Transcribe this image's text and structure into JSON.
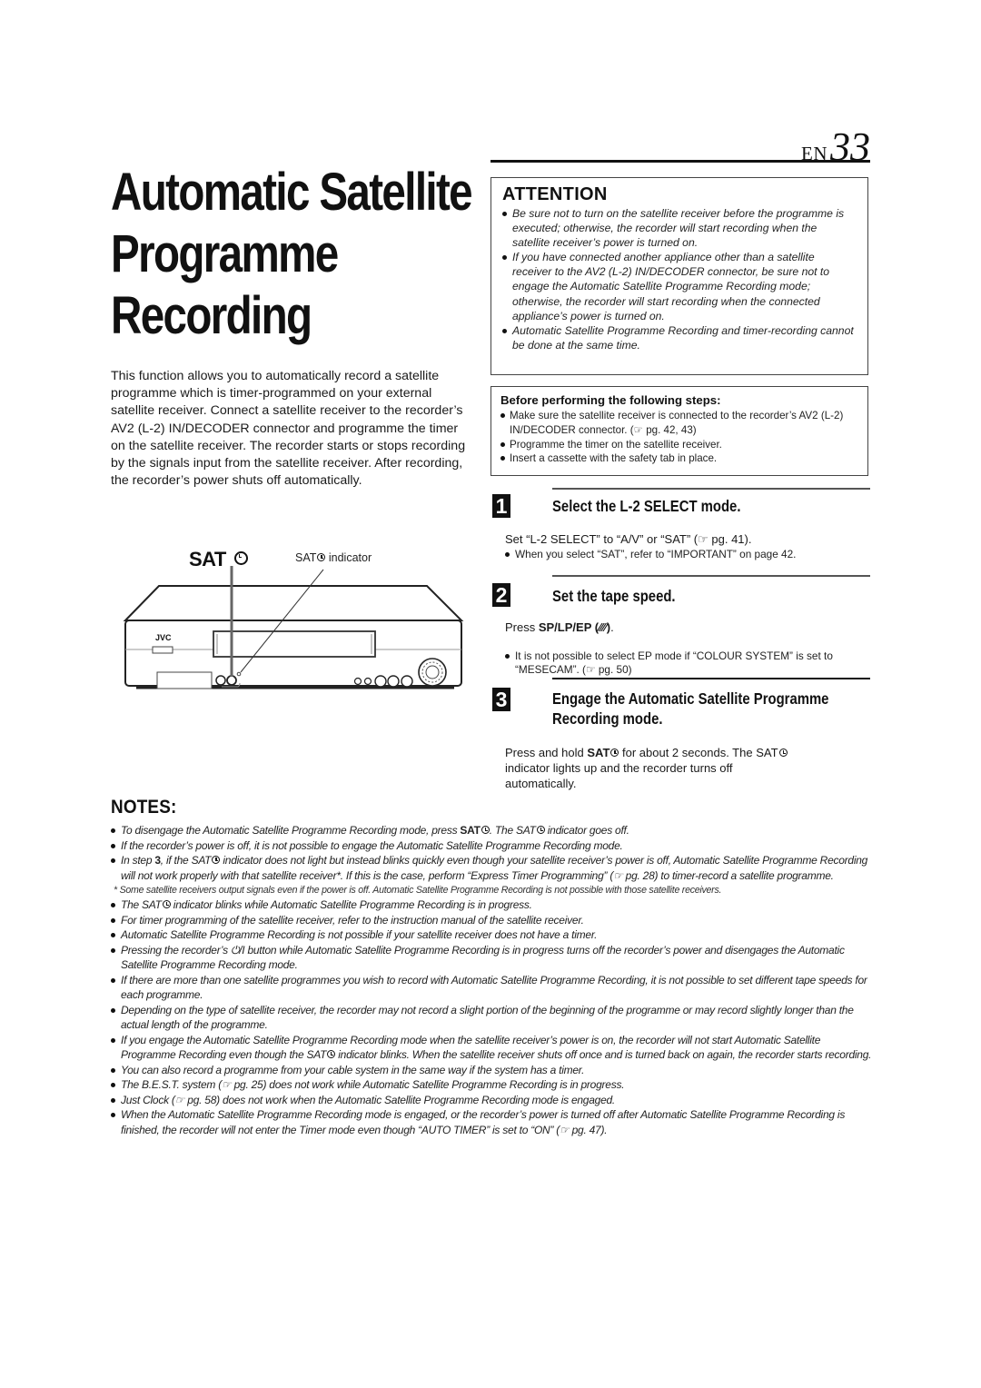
{
  "header": {
    "lang": "EN",
    "page_number": "33"
  },
  "title": {
    "line1": "Automatic Satellite",
    "line2": "Programme",
    "line3": "Recording"
  },
  "intro": "This function allows you to automatically record a satellite programme which is timer-programmed on your external satellite receiver. Connect a satellite receiver to the recorder’s AV2 (L-2) IN/DECODER connector and programme the timer on the satellite receiver. The recorder starts or stops recording by the signals input from the satellite receiver. After recording, the recorder’s power shuts off automatically.",
  "diagram": {
    "button_label": "SAT",
    "indicator_label": "SAT",
    "indicator_suffix": " indicator",
    "brand": "JVC"
  },
  "attention": {
    "heading": "ATTENTION",
    "items": [
      "Be sure not to turn on the satellite receiver before the programme is executed; otherwise, the recorder will start recording when the satellite receiver’s power is turned on.",
      "If you have connected another appliance other than a satellite receiver to the AV2 (L-2) IN/DECODER connector, be sure not to engage the Automatic Satellite Programme Recording mode; otherwise, the recorder will start recording when the connected appliance’s power is turned on.",
      "Automatic Satellite Programme Recording and timer-recording cannot be done at the same time."
    ]
  },
  "before": {
    "heading": "Before performing the following steps:",
    "items": [
      "Make sure the satellite receiver is connected to the recorder’s AV2 (L-2) IN/DECODER connector. (☞ pg. 42, 43)",
      "Programme the timer on the satellite receiver.",
      "Insert a cassette with the safety tab in place."
    ]
  },
  "steps": [
    {
      "number": "1",
      "title": "Select the L-2 SELECT mode.",
      "body": "Set  “L-2 SELECT” to “A/V” or “SAT” (☞ pg. 41).",
      "note": "When you select “SAT”, refer to “IMPORTANT” on page 42."
    },
    {
      "number": "2",
      "title": "Set the tape speed.",
      "body_prefix": "Press ",
      "body_bold": "SP/LP/EP (⁄⁄⁄⁄)",
      "body_suffix": ".",
      "note": "It is not possible to select EP mode if “COLOUR SYSTEM” is set to “MESECAM”. (☞ pg. 50)"
    },
    {
      "number": "3",
      "title_line1": "Engage the Automatic Satellite Programme",
      "title_line2": "Recording mode.",
      "body_prefix": "Press and hold ",
      "body_bold": "SAT",
      "body_mid": " for about 2 seconds. The SAT",
      "body_suffix": " indicator lights up and the recorder turns off automatically."
    }
  ],
  "notes": {
    "heading": "NOTES:",
    "n1_a": "To disengage the Automatic Satellite Programme Recording mode, press ",
    "n1_bold": "SAT",
    "n1_b": ". The SAT",
    "n1_c": " indicator goes off.",
    "n2": "If the recorder’s power is off, it is not possible to engage the Automatic Satellite Programme Recording mode.",
    "n3_a": "In step ",
    "n3_bold": "3",
    "n3_b": ", if the SAT",
    "n3_c": " indicator does not light but instead blinks quickly even though your satellite receiver’s power is off, Automatic Satellite Programme Recording will not work properly with that satellite receiver*. If this is the case, perform “Express Timer Programming” (☞ pg. 28) to timer-record a satellite programme.",
    "footnote": "* Some satellite receivers output signals even if the power is off. Automatic Satellite Programme Recording is not possible with those satellite receivers.",
    "n4_a": "The SAT",
    "n4_b": " indicator blinks while Automatic Satellite Programme Recording is in progress.",
    "n5": "For timer programming of the satellite receiver, refer to the instruction manual of the satellite receiver.",
    "n6": "Automatic Satellite Programme Recording is not possible if your satellite receiver does not have a timer.",
    "n7": "Pressing the recorder’s ⏻/I button while Automatic Satellite Programme Recording is in progress turns off the recorder’s power and disengages the Automatic Satellite Programme Recording mode.",
    "n8": "If there are more than one satellite programmes you wish to record with Automatic Satellite Programme Recording, it is not possible to set different tape speeds for each programme.",
    "n9": "Depending on the type of satellite receiver, the recorder may not record a slight portion of the beginning of the programme or may record slightly longer than the actual length of the programme.",
    "n10_a": "If you engage the Automatic Satellite Programme Recording mode when the satellite receiver’s power is on, the recorder will not start Automatic Satellite Programme Recording even though the SAT",
    "n10_b": " indicator blinks. When the satellite receiver shuts off once and is turned back on again, the recorder starts recording.",
    "n11": "You can also record a programme from your cable system in the same way if the system has a timer.",
    "n12": "The B.E.S.T. system (☞ pg. 25) does not work while Automatic Satellite Programme Recording is in progress.",
    "n13": "Just Clock (☞ pg. 58) does not work when the Automatic Satellite Programme Recording mode is engaged.",
    "n14": "When the Automatic Satellite Programme Recording mode is engaged, or the recorder’s power is turned off after Automatic Satellite Programme Recording is finished, the recorder will not enter the Timer mode even though “AUTO TIMER” is set to “ON” (☞ pg. 47)."
  }
}
